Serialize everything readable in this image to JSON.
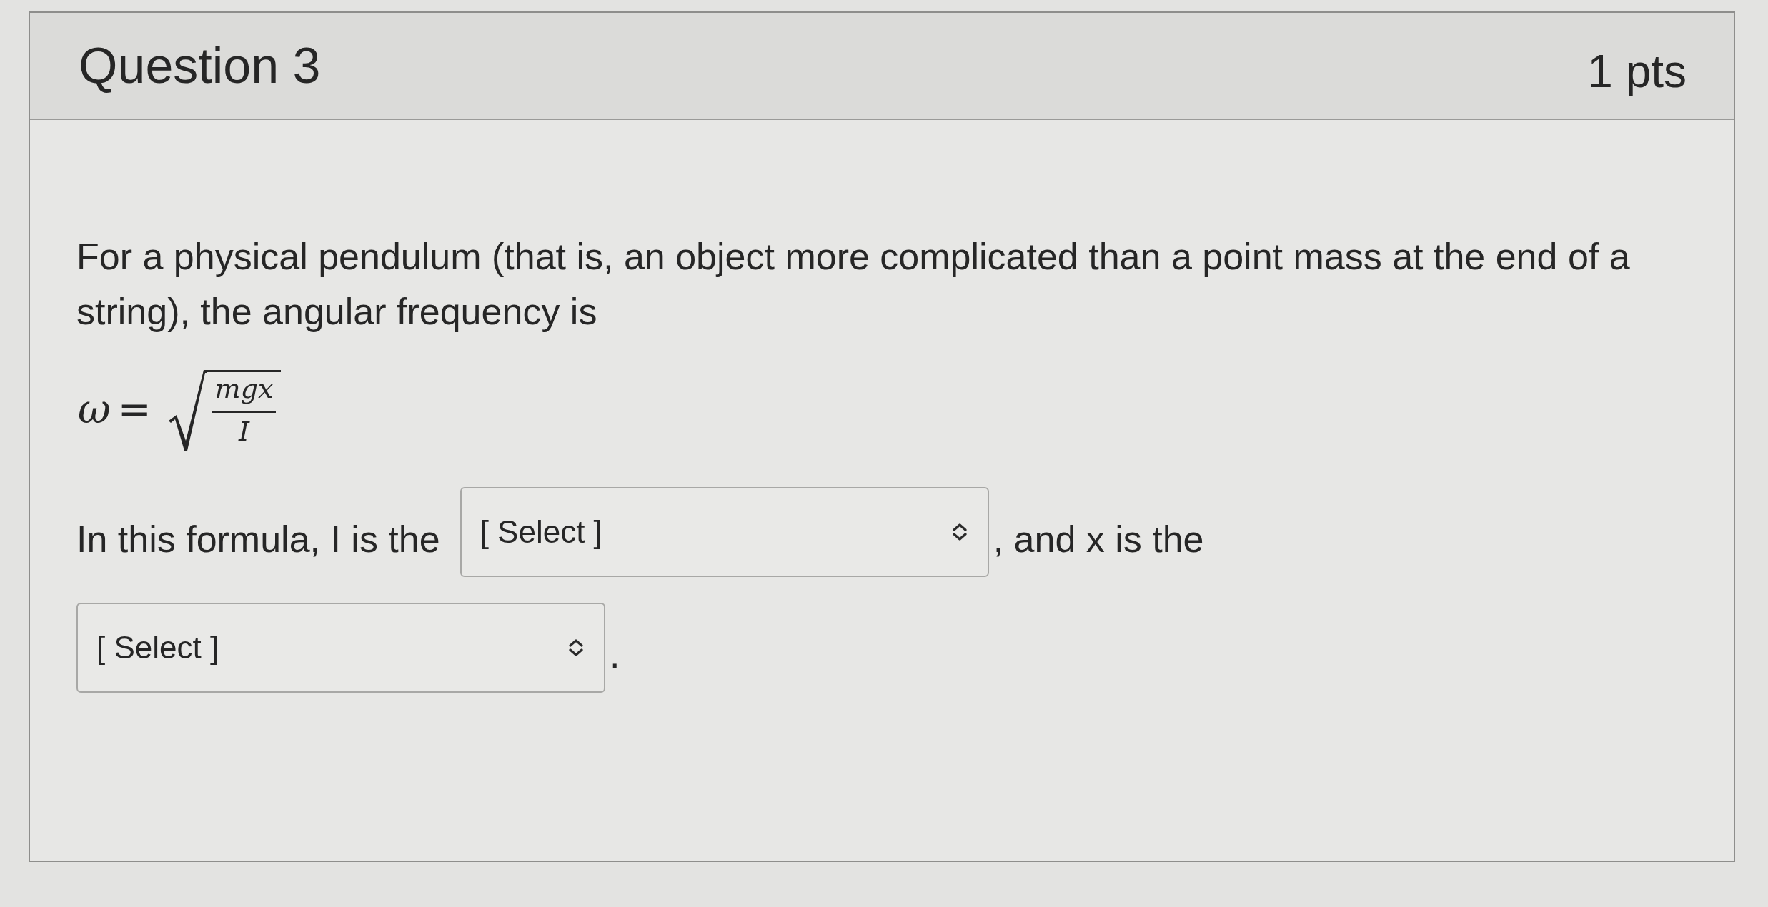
{
  "question": {
    "title": "Question 3",
    "points": "1 pts"
  },
  "prompt": "For a physical pendulum (that is, an object more complicated than a point mass at the end of a string), the angular frequency is",
  "formula": {
    "lhs": "ω",
    "relation": "=",
    "numerator": "mgx",
    "denominator": "I"
  },
  "sentence": [
    {
      "kind": "text",
      "text": "In this formula, I is the"
    },
    {
      "kind": "select",
      "value": "[ Select ]"
    },
    {
      "kind": "text",
      "text": ", and x is the"
    },
    {
      "kind": "select",
      "value": "[ Select ]"
    },
    {
      "kind": "text",
      "text": "."
    }
  ]
}
